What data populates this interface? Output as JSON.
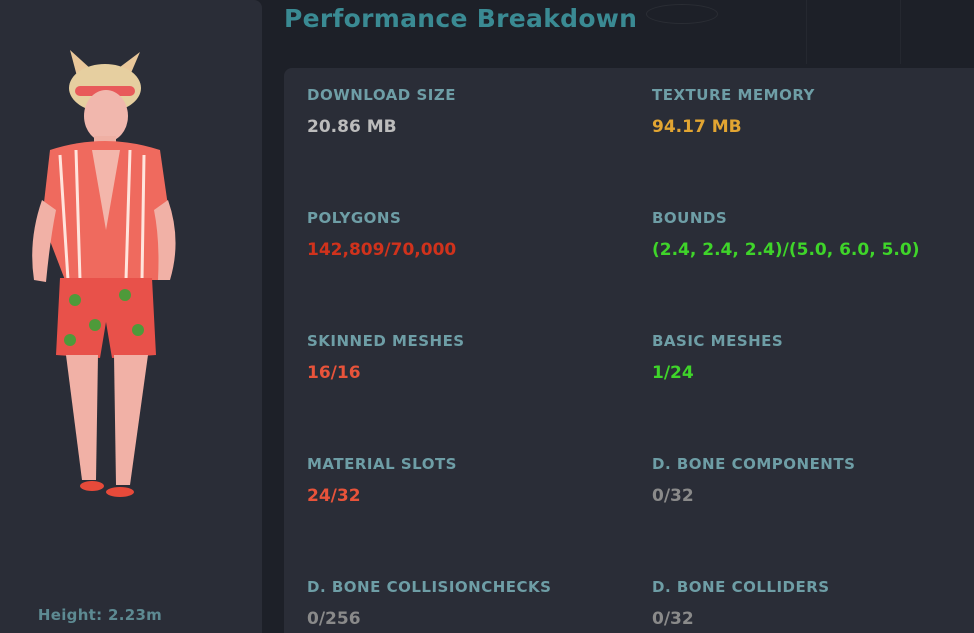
{
  "header": {
    "title": "Performance Breakdown"
  },
  "avatar": {
    "height_label": "Height: 2.23m"
  },
  "colors": {
    "neutral": "#bcbcbc",
    "gray": "#8a8a8a",
    "warning": "#e2a532",
    "bad": "#d0321c",
    "poor": "#e8533a",
    "good": "#3fd42a",
    "label": "#6e9ea6",
    "title": "#3a8a93"
  },
  "stats": [
    {
      "label": "DOWNLOAD SIZE",
      "value": "20.86 MB",
      "color": "#bcbcbc"
    },
    {
      "label": "TEXTURE MEMORY",
      "value": "94.17 MB",
      "color": "#e2a532"
    },
    {
      "label": "POLYGONS",
      "value": "142,809/70,000",
      "color": "#d0321c"
    },
    {
      "label": "BOUNDS",
      "value": "(2.4, 2.4, 2.4)/(5.0, 6.0, 5.0)",
      "color": "#3fd42a"
    },
    {
      "label": "SKINNED MESHES",
      "value": "16/16",
      "color": "#e8533a"
    },
    {
      "label": "BASIC MESHES",
      "value": "1/24",
      "color": "#3fd42a"
    },
    {
      "label": "MATERIAL SLOTS",
      "value": "24/32",
      "color": "#e8533a"
    },
    {
      "label": "D. BONE COMPONENTS",
      "value": "0/32",
      "color": "#8a8a8a"
    },
    {
      "label": "D. BONE COLLISIONCHECKS",
      "value": "0/256",
      "color": "#8a8a8a"
    },
    {
      "label": "D. BONE COLLIDERS",
      "value": "0/32",
      "color": "#8a8a8a"
    }
  ]
}
